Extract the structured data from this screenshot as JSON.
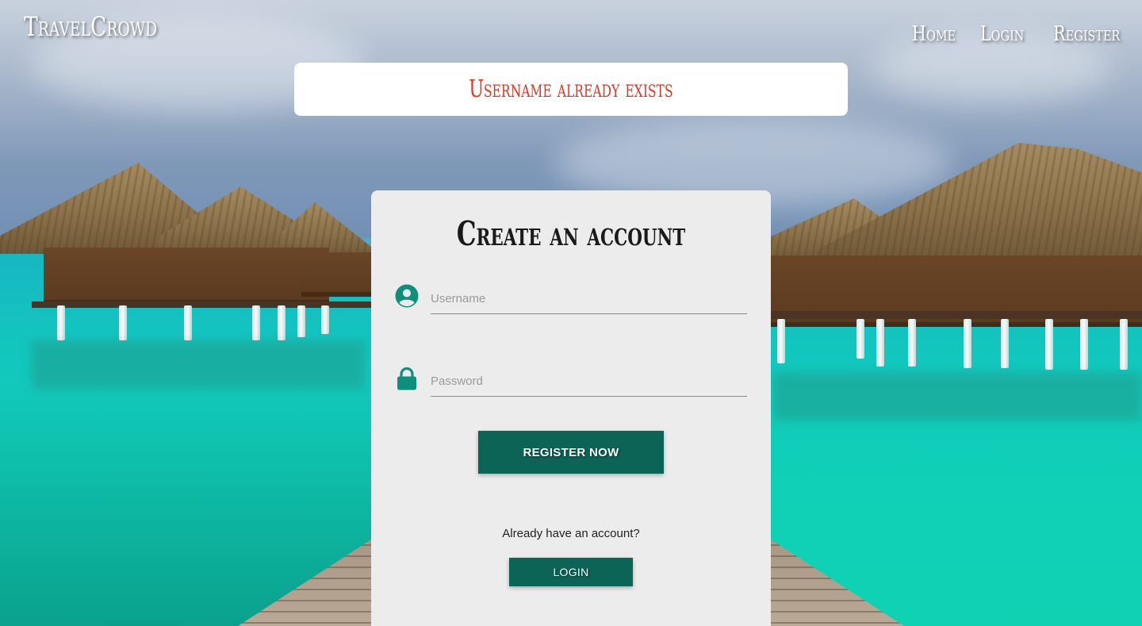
{
  "brand": {
    "name": "TravelCrowd"
  },
  "nav": {
    "items": [
      {
        "label": "Home"
      },
      {
        "label": "Login"
      },
      {
        "label": "Register"
      }
    ]
  },
  "flash": {
    "message": "Username already exists",
    "color": "#e8321f"
  },
  "form": {
    "title": "Create an account",
    "username": {
      "placeholder": "Username",
      "value": "",
      "icon": "account-circle-icon"
    },
    "password": {
      "placeholder": "Password",
      "value": "",
      "icon": "lock-icon"
    },
    "submit_label": "Register Now",
    "login_prompt": "Already have an account?",
    "login_label": "Login"
  },
  "colors": {
    "accent": "#0b6456",
    "icon": "#0e8f7b",
    "card": "#ececec"
  }
}
